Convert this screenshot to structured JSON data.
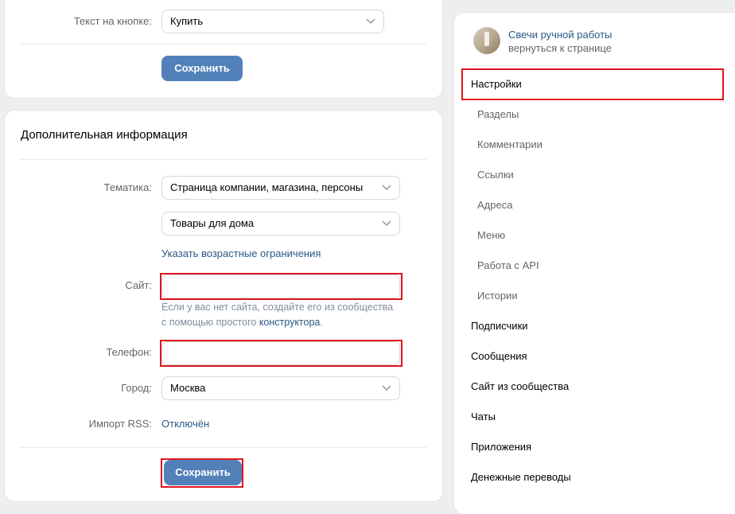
{
  "top_card": {
    "button_text_label": "Текст на кнопке:",
    "button_text_value": "Купить",
    "save_label": "Сохранить"
  },
  "info_card": {
    "title": "Дополнительная информация",
    "topic_label": "Тематика:",
    "topic_value": "Страница компании, магазина, персоны",
    "subtopic_value": "Товары для дома",
    "age_limit_link": "Указать возрастные ограничения",
    "site_label": "Сайт:",
    "site_value": "",
    "site_hint_prefix": "Если у вас нет сайта, создайте его из сообщества",
    "site_hint_line2": "с помощью простого ",
    "site_hint_link": "конструктора",
    "site_hint_suffix": ".",
    "phone_label": "Телефон:",
    "phone_value": "",
    "city_label": "Город:",
    "city_value": "Москва",
    "rss_label": "Импорт RSS:",
    "rss_value": "Отключён",
    "save_label": "Сохранить"
  },
  "sidebar": {
    "community_name": "Свечи ручной работы",
    "back_link": "вернуться к странице",
    "items": [
      {
        "label": "Настройки"
      },
      {
        "label": "Разделы"
      },
      {
        "label": "Комментарии"
      },
      {
        "label": "Ссылки"
      },
      {
        "label": "Адреса"
      },
      {
        "label": "Меню"
      },
      {
        "label": "Работа с API"
      },
      {
        "label": "Истории"
      },
      {
        "label": "Подписчики"
      },
      {
        "label": "Сообщения"
      },
      {
        "label": "Сайт из сообщества"
      },
      {
        "label": "Чаты"
      },
      {
        "label": "Приложения"
      },
      {
        "label": "Денежные переводы"
      }
    ]
  },
  "colors": {
    "accent": "#5181b8",
    "link": "#2a5885",
    "highlight": "#e0141e"
  }
}
